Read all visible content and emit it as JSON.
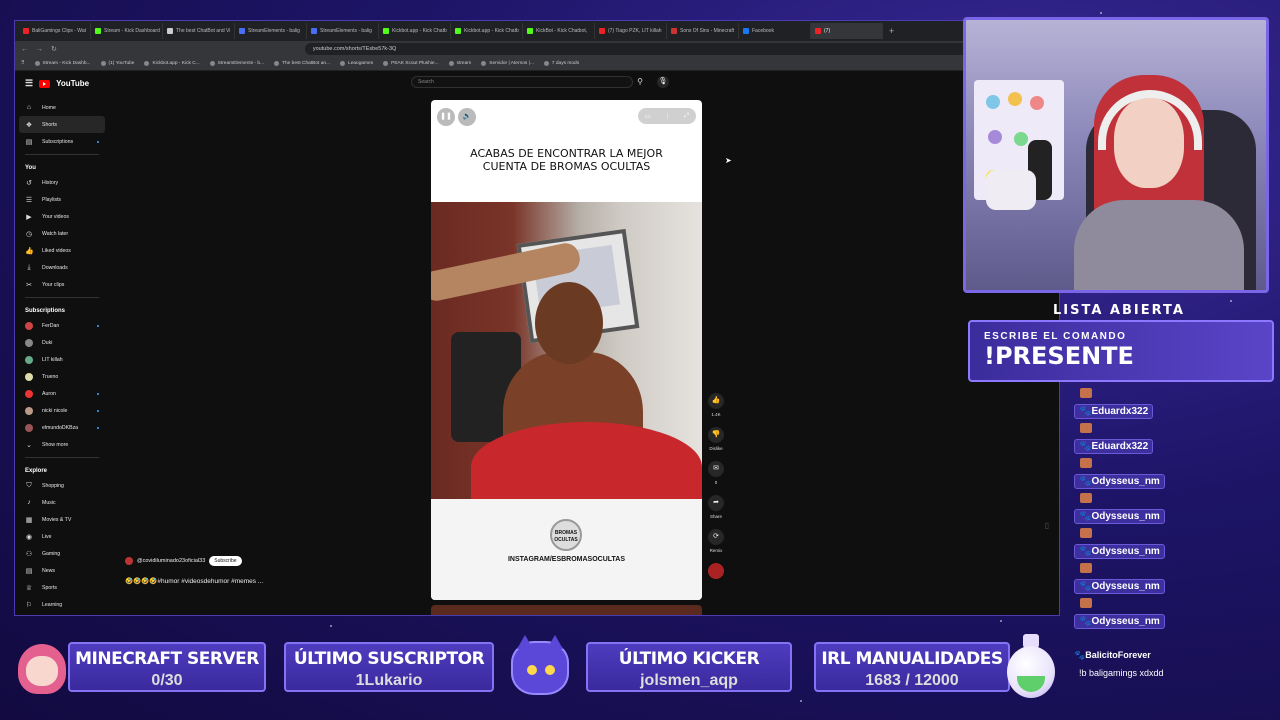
{
  "browser": {
    "tabs": [
      {
        "label": "BaliGamings Clips - Wat",
        "color": "#e22"
      },
      {
        "label": "Stream - Kick Dashboard",
        "color": "#53fc18"
      },
      {
        "label": "The best ChatBot and Vi",
        "color": "#ccc"
      },
      {
        "label": "StreamElements - balig",
        "color": "#4a6cf7"
      },
      {
        "label": "StreamElements - balig",
        "color": "#4a6cf7"
      },
      {
        "label": "Kickbot.app - Kick Chatb",
        "color": "#53fc18"
      },
      {
        "label": "Kickbot.app - Kick Chatb",
        "color": "#53fc18"
      },
      {
        "label": "KickBot - Kick Chatbot, ",
        "color": "#53fc18"
      },
      {
        "label": "(7) Tiago PZK, LIT killah",
        "color": "#e22"
      },
      {
        "label": "Sons Of Sins - Minecraft",
        "color": "#c33"
      },
      {
        "label": "Facebook",
        "color": "#1877f2"
      },
      {
        "label": "(7)",
        "color": "#e22",
        "active": true
      }
    ],
    "url": "youtube.com/shorts/TEsbe57k-3Q",
    "bookmarks": [
      "Stream - Kick Dashb...",
      "(1) YouTube",
      "Kickbot.app - Kick C...",
      "StreamElements - b...",
      "The best ChatBot an...",
      "Leaogames",
      "PEAK Scout Plushie...",
      "stream",
      "Servidor | Aternos |...",
      "7 days mods"
    ]
  },
  "youtube": {
    "logo_text": "YouTube",
    "search_placeholder": "Search",
    "nav_main": [
      {
        "label": "Home",
        "icon": "⌂"
      },
      {
        "label": "Shorts",
        "icon": "❖",
        "active": true
      },
      {
        "label": "Subscriptions",
        "icon": "▤",
        "dot": true
      }
    ],
    "you_header": "You",
    "nav_you": [
      {
        "label": "History",
        "icon": "↺"
      },
      {
        "label": "Playlists",
        "icon": "☰"
      },
      {
        "label": "Your videos",
        "icon": "▶"
      },
      {
        "label": "Watch later",
        "icon": "◷"
      },
      {
        "label": "Liked videos",
        "icon": "👍"
      },
      {
        "label": "Downloads",
        "icon": "⤓"
      },
      {
        "label": "Your clips",
        "icon": "✂"
      }
    ],
    "subs_header": "Subscriptions",
    "subscriptions": [
      {
        "label": "FerDan",
        "color": "#c44",
        "dot": true
      },
      {
        "label": "Duki",
        "color": "#888"
      },
      {
        "label": "LIT killah",
        "color": "#6a8"
      },
      {
        "label": "Trueno",
        "color": "#dda"
      },
      {
        "label": "Auron",
        "color": "#e33",
        "dot": true
      },
      {
        "label": "nicki nicole",
        "color": "#b98",
        "dot": true
      },
      {
        "label": "elmundoDKBza",
        "color": "#955",
        "dot": true
      }
    ],
    "show_more": "Show more",
    "explore_header": "Explore",
    "explore": [
      {
        "label": "Shopping",
        "icon": "⛉"
      },
      {
        "label": "Music",
        "icon": "♪"
      },
      {
        "label": "Movies & TV",
        "icon": "▦"
      },
      {
        "label": "Live",
        "icon": "◉"
      },
      {
        "label": "Gaming",
        "icon": "⚇"
      },
      {
        "label": "News",
        "icon": "▤"
      },
      {
        "label": "Sports",
        "icon": "♕"
      },
      {
        "label": "Learning",
        "icon": "⚐"
      }
    ],
    "video": {
      "title": "ACABAS DE ENCONTRAR LA MEJOR CUENTA DE BROMAS OCULTAS",
      "badge": "BROMAS OCULTAS",
      "instagram": "INSTAGRAM/ESBROMASOCULTAS",
      "channel": "@covidiluminado23oficial33",
      "subscribe": "Subscribe",
      "description": "🤣🤣🤣🤣#humor #videosdehumor #memes ..."
    },
    "actions": [
      {
        "label": "1.4K",
        "icon": "👍"
      },
      {
        "label": "Dislike",
        "icon": "👎"
      },
      {
        "label": "0",
        "icon": "✉"
      },
      {
        "label": "Share",
        "icon": "➦"
      },
      {
        "label": "Remix",
        "icon": "⟳"
      }
    ]
  },
  "overlay": {
    "lista": "LISTA ABIERTA",
    "cmd_label": "ESCRIBE EL COMANDO",
    "cmd": "!PRESENTE",
    "chat": [
      {
        "user": "Eduardx322"
      },
      {
        "user": "Eduardx322"
      },
      {
        "user": "Odysseus_nm"
      },
      {
        "user": "Odysseus_nm"
      },
      {
        "user": "Odysseus_nm"
      },
      {
        "user": "Odysseus_nm"
      },
      {
        "user": "Odysseus_nm"
      }
    ],
    "last_user": "BalicitoForever",
    "last_message": "!b baligamings xdxdd",
    "bottom": [
      {
        "title": "MINECRAFT SERVER",
        "value": "0/30"
      },
      {
        "title": "ÚLTIMO SUSCRIPTOR",
        "value": "1Lukario"
      },
      {
        "title": "ÚLTIMO KICKER",
        "value": "jolsmen_aqp"
      },
      {
        "title": "IRL MANUALIDADES",
        "value": "1683 / 12000"
      }
    ]
  }
}
